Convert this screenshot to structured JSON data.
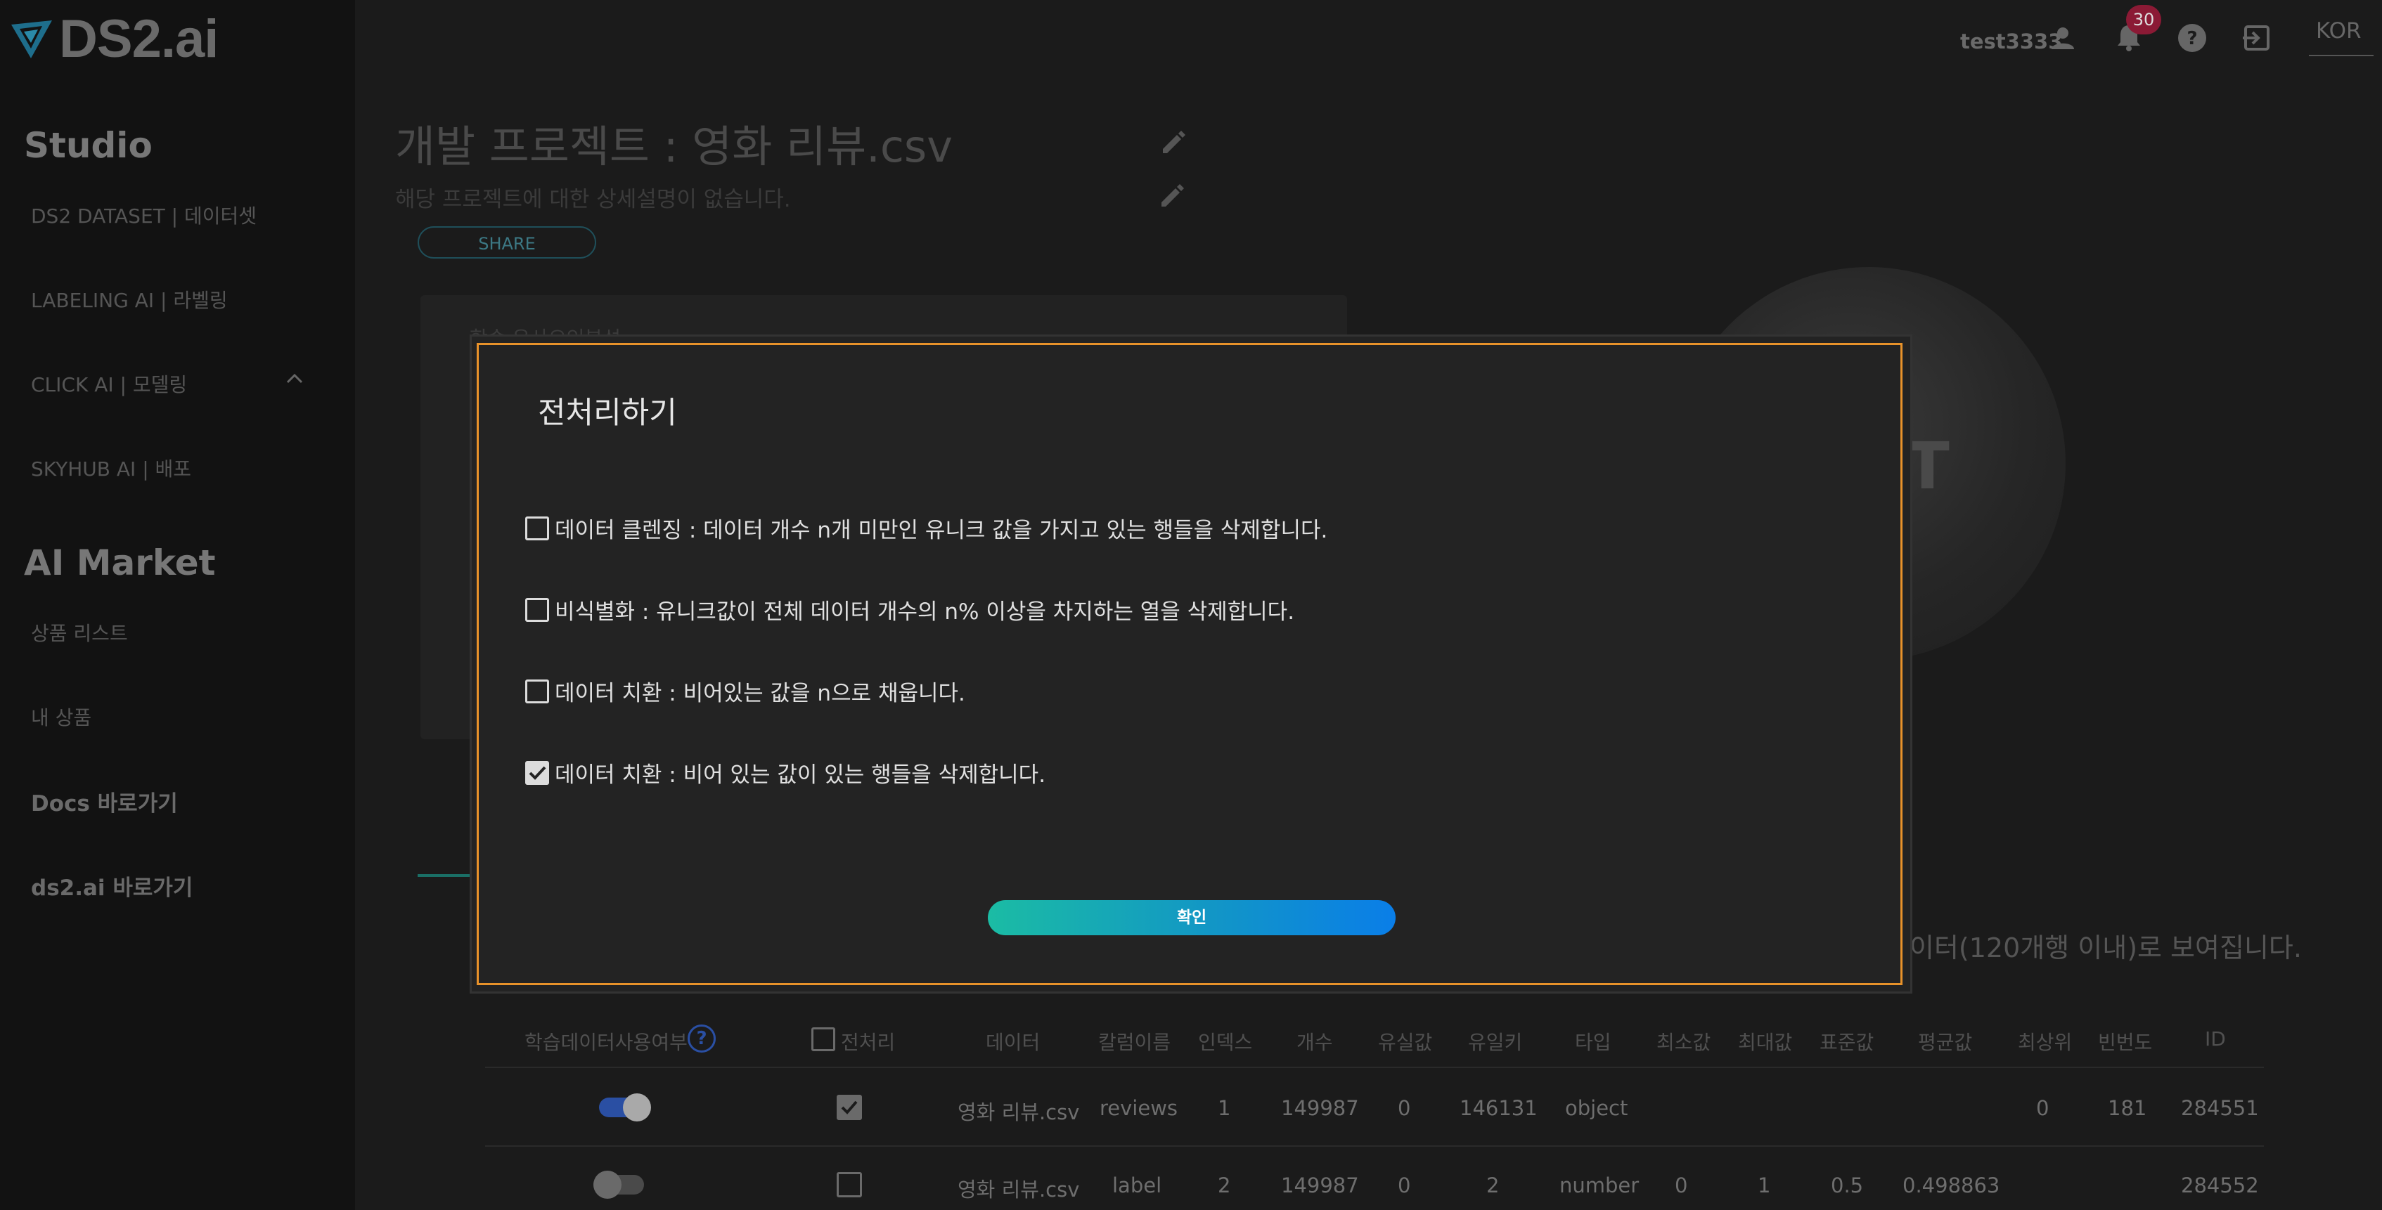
{
  "app": {
    "logo_text": "DS2.ai"
  },
  "sidebar": {
    "studio_title": "Studio",
    "studio_items": [
      {
        "label": "DS2 DATASET | 데이터셋"
      },
      {
        "label": "LABELING AI | 라벨링"
      },
      {
        "label": "CLICK AI | 모델링"
      },
      {
        "label": "SKYHUB AI | 배포"
      }
    ],
    "market_title": "AI Market",
    "market_items": [
      {
        "label": "상품 리스트"
      },
      {
        "label": "내 상품"
      }
    ],
    "docs_link": "Docs 바로가기",
    "site_link": "ds2.ai 바로가기"
  },
  "topbar": {
    "username": "test3333",
    "notification_count": "30",
    "language": "KOR"
  },
  "project": {
    "title": "개발 프로젝트 : 영화 리뷰.csv",
    "description": "해당 프로젝트에 대한 상세설명이 없습니다.",
    "share_label": "SHARE",
    "card_label": "학습 유사요인분석",
    "sphere_letter": "T",
    "preview_note": "이터(120개행 이내)로 보여집니다."
  },
  "modal": {
    "title": "전처리하기",
    "options": [
      {
        "label": "데이터 클렌징 : 데이터 개수 n개 미만인 유니크 값을 가지고 있는 행들을 삭제합니다.",
        "checked": false
      },
      {
        "label": "비식별화 : 유니크값이 전체 데이터 개수의 n% 이상을 차지하는 열을 삭제합니다.",
        "checked": false
      },
      {
        "label": "데이터 치환 : 비어있는 값을 n으로 채웁니다.",
        "checked": false
      },
      {
        "label": "데이터 치환 : 비어 있는 값이 있는 행들을 삭제합니다.",
        "checked": true
      }
    ],
    "confirm_label": "확인"
  },
  "table": {
    "headers": {
      "use_training": "학습데이터사용여부",
      "preprocess": "전처리",
      "data": "데이터",
      "column_name": "칼럼이름",
      "index": "인덱스",
      "count": "개수",
      "missing": "유실값",
      "unique": "유일키",
      "type": "타입",
      "min": "최소값",
      "max": "최대값",
      "std": "표준값",
      "mean": "평균값",
      "top": "최상위",
      "freq": "빈번도",
      "id": "ID"
    },
    "rows": [
      {
        "use_training": true,
        "preprocess": true,
        "data": "영화 리뷰.csv",
        "column_name": "reviews",
        "index": "1",
        "count": "149987",
        "missing": "0",
        "unique": "146131",
        "type": "object",
        "min": "",
        "max": "",
        "std": "",
        "mean": "",
        "top": "0",
        "freq": "181",
        "id": "284551"
      },
      {
        "use_training": false,
        "preprocess": false,
        "data": "영화 리뷰.csv",
        "column_name": "label",
        "index": "2",
        "count": "149987",
        "missing": "0",
        "unique": "2",
        "type": "number",
        "min": "0",
        "max": "1",
        "std": "0.5",
        "mean": "0.498863",
        "top": "",
        "freq": "",
        "id": "284552"
      }
    ]
  },
  "colors": {
    "modal_border": "#e8922a",
    "accent_teal": "#1bbca4",
    "accent_blue": "#0a7ee8",
    "badge": "#8b1a35"
  }
}
